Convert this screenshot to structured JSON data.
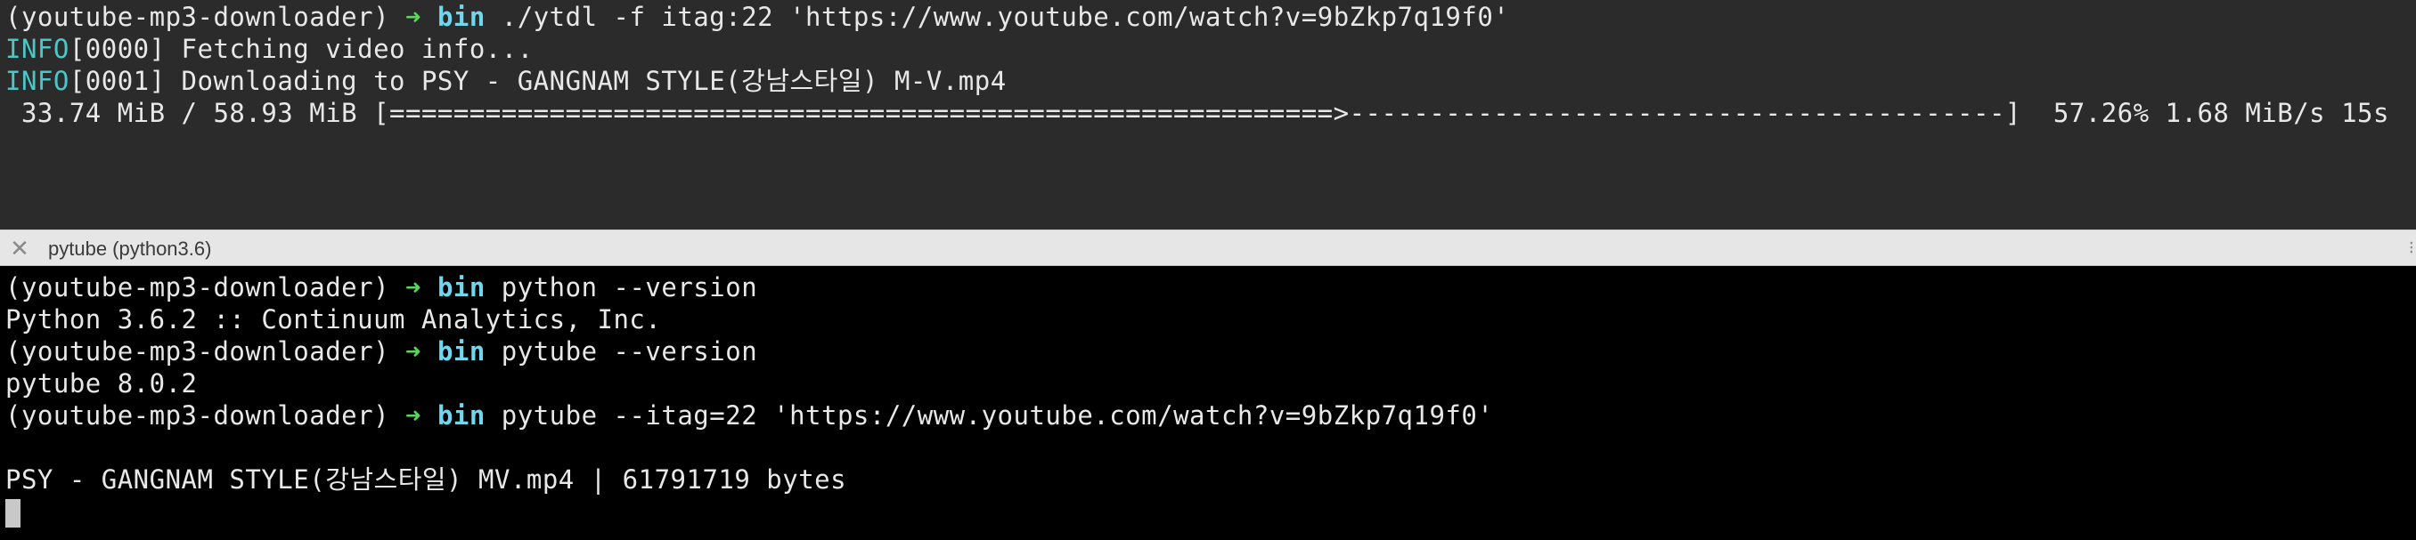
{
  "top_pane": {
    "line1": {
      "prompt_env": "(youtube-mp3-downloader)",
      "arrow": "➜",
      "dir": "bin",
      "command": "./ytdl -f itag:22 'https://www.youtube.com/watch?v=9bZkp7q19f0'"
    },
    "line2": {
      "level": "INFO",
      "text": "[0000] Fetching video info..."
    },
    "line3": {
      "level": "INFO",
      "text": "[0001] Downloading to PSY - GANGNAM STYLE(강남스타일) M-V.mp4"
    },
    "line4": {
      "text": " 33.74 MiB / 58.93 MiB [===========================================================>-----------------------------------------]  57.26% 1.68 MiB/s 15s"
    }
  },
  "tab": {
    "title": "pytube (python3.6)",
    "close_glyph": "✕",
    "dots_glyph": "⁝"
  },
  "bottom_pane": {
    "line1": {
      "prompt_env": "(youtube-mp3-downloader)",
      "arrow": "➜",
      "dir": "bin",
      "command": "python --version"
    },
    "line2": {
      "text": "Python 3.6.2 :: Continuum Analytics, Inc."
    },
    "line3": {
      "prompt_env": "(youtube-mp3-downloader)",
      "arrow": "➜",
      "dir": "bin",
      "command": "pytube --version"
    },
    "line4": {
      "text": "pytube 8.0.2"
    },
    "line5": {
      "prompt_env": "(youtube-mp3-downloader)",
      "arrow": "➜",
      "dir": "bin",
      "command": "pytube --itag=22 'https://www.youtube.com/watch?v=9bZkp7q19f0'"
    },
    "line6": {
      "text": ""
    },
    "line7": {
      "text": "PSY - GANGNAM STYLE(강남스타일) MV.mp4 | 61791719 bytes"
    }
  },
  "colors": {
    "top_bg": "#2b2b2b",
    "bottom_bg": "#000000",
    "info": "#4cc6c6",
    "arrow": "#5cd55c",
    "dir": "#6fd8ee",
    "text": "#e8e8e8"
  }
}
